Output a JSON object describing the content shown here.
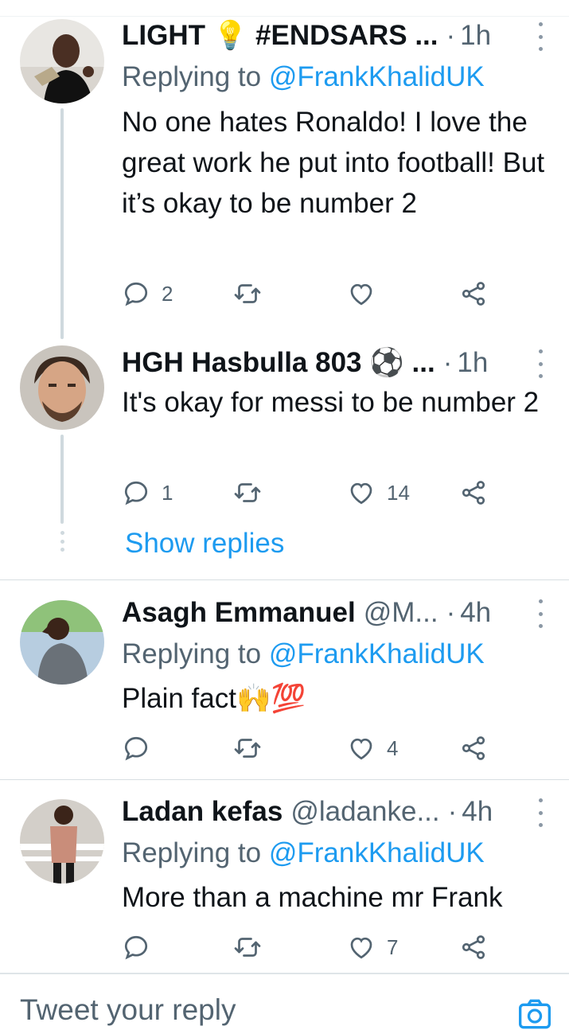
{
  "colors": {
    "accent": "#1d9bf0",
    "secondary_text": "#536471",
    "primary_text": "#0f1419"
  },
  "tweets": [
    {
      "name": "LIGHT 💡 #ENDSARS ...",
      "handle": "",
      "time": "1h",
      "replying_prefix": "Replying to",
      "replying_to": "@FrankKhalidUK",
      "body": "No one hates Ronaldo! I love the great work he put into football! But it’s okay to be number 2",
      "reply_count": "2",
      "retweet_count": "",
      "like_count": "",
      "avatar_icon": "profile-photo"
    },
    {
      "name": "HGH Hasbulla 803 ⚽ ...",
      "handle": "",
      "time": "1h",
      "replying_prefix": "",
      "replying_to": "",
      "body": "It's okay for messi to be number 2",
      "reply_count": "1",
      "retweet_count": "",
      "like_count": "14",
      "avatar_icon": "profile-photo"
    },
    {
      "name": "Asagh Emmanuel",
      "handle": "@M...",
      "time": "4h",
      "replying_prefix": "Replying to",
      "replying_to": "@FrankKhalidUK",
      "body": "Plain fact🙌💯",
      "reply_count": "",
      "retweet_count": "",
      "like_count": "4",
      "avatar_icon": "profile-photo"
    },
    {
      "name": "Ladan kefas",
      "handle": "@ladanke...",
      "time": "4h",
      "replying_prefix": "Replying to",
      "replying_to": "@FrankKhalidUK",
      "body": "More than a machine mr Frank",
      "reply_count": "",
      "retweet_count": "",
      "like_count": "7",
      "avatar_icon": "profile-photo"
    }
  ],
  "show_replies_label": "Show replies",
  "compose": {
    "placeholder": "Tweet your reply",
    "camera_icon": "camera-icon"
  }
}
